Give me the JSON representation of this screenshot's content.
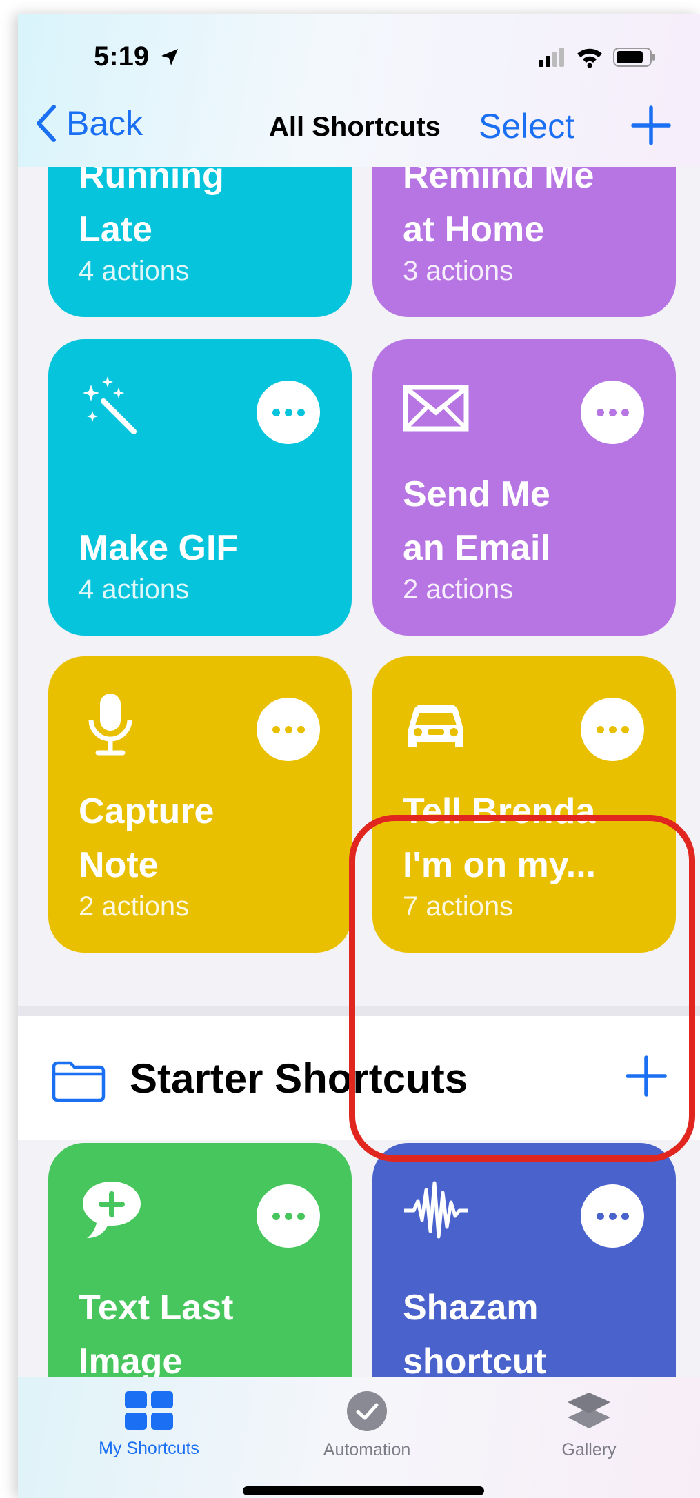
{
  "status_bar": {
    "time": "5:19"
  },
  "nav": {
    "back_label": "Back",
    "title": "All Shortcuts",
    "select_label": "Select"
  },
  "tiles": [
    {
      "title": "Running\nLate",
      "subtitle": "4 actions",
      "color": "#05c4dc"
    },
    {
      "title": "Remind Me\nat Home",
      "subtitle": "3 actions",
      "color": "#b775e3"
    },
    {
      "title": "Make GIF",
      "subtitle": "4 actions",
      "icon": "magic-wand-icon",
      "color": "#05c4dc"
    },
    {
      "title": "Send Me\nan Email",
      "subtitle": "2 actions",
      "icon": "envelope-icon",
      "color": "#b775e3"
    },
    {
      "title": "Capture\nNote",
      "subtitle": "2 actions",
      "icon": "microphone-icon",
      "color": "#e9c000"
    },
    {
      "title": "Tell Brenda\nI'm on my...",
      "subtitle": "7 actions",
      "icon": "car-icon",
      "color": "#e9c000"
    }
  ],
  "starter_section": {
    "title": "Starter Shortcuts",
    "tiles": [
      {
        "title": "Text Last\nImage",
        "icon": "message-plus-icon",
        "color": "#46c65c"
      },
      {
        "title": "Shazam\nshortcut",
        "icon": "waveform-icon",
        "color": "#4a63cc"
      }
    ]
  },
  "tab_bar": {
    "tabs": [
      {
        "label": "My Shortcuts",
        "icon": "grid-icon",
        "active": true
      },
      {
        "label": "Automation",
        "icon": "clock-check-icon",
        "active": false
      },
      {
        "label": "Gallery",
        "icon": "layers-icon",
        "active": false
      }
    ]
  },
  "highlight_color": "#e0261f"
}
